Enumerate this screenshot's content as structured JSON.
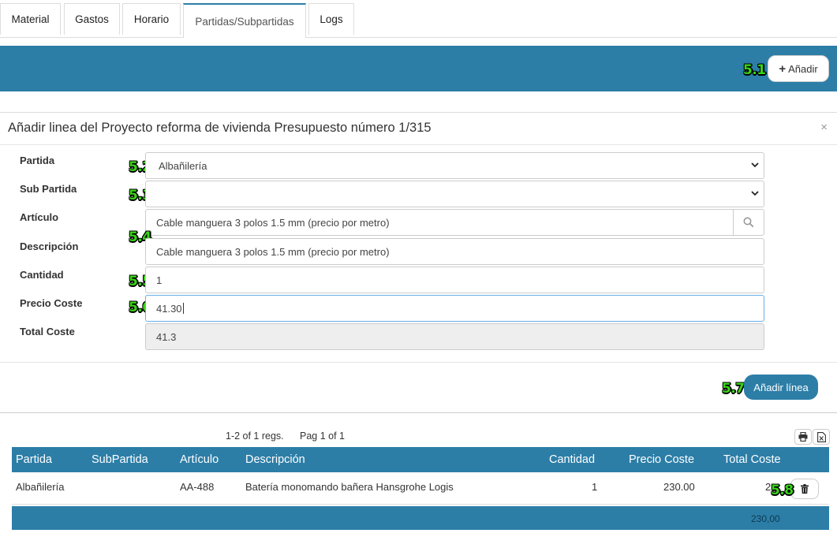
{
  "tabs": [
    {
      "label": "Material"
    },
    {
      "label": "Gastos"
    },
    {
      "label": "Horario"
    },
    {
      "label": "Partidas/Subpartidas",
      "active": true
    },
    {
      "label": "Logs"
    }
  ],
  "toolbar": {
    "add_label": "Añadir"
  },
  "badges": {
    "b51": "5.1",
    "b52": "5.2",
    "b53": "5.3",
    "b54": "5.4",
    "b55": "5.5",
    "b56": "5.6",
    "b57": "5.7",
    "b58": "5.8"
  },
  "form": {
    "title": "Añadir linea del Proyecto reforma de vivienda Presupuesto número 1/315",
    "close": "×",
    "partida_label": "Partida",
    "partida_value": "Albañilería",
    "subpartida_label": "Sub Partida",
    "subpartida_value": "",
    "articulo_label": "Artículo",
    "articulo_value": "Cable manguera 3 polos 1.5 mm (precio por metro)",
    "descripcion_label": "Descripción",
    "descripcion_value": "Cable manguera 3 polos 1.5 mm (precio por metro)",
    "cantidad_label": "Cantidad",
    "cantidad_value": "1",
    "precio_label": "Precio Coste",
    "precio_value": "41.30",
    "total_label": "Total Coste",
    "total_value": "41.3",
    "submit_label": "Añadir línea"
  },
  "table": {
    "records": "1-2 of 1 regs.",
    "pages": "Pag 1 of 1",
    "columns": [
      "Partida",
      "SubPartida",
      "Artículo",
      "Descripción",
      "Cantidad",
      "Precio Coste",
      "Total Coste"
    ],
    "rows": [
      {
        "partida": "Albañilería",
        "subpartida": "",
        "articulo": "AA-488",
        "descripcion": "Batería monomando bañera Hansgrohe Logis",
        "cantidad": "1",
        "precio": "230.00",
        "total": "2"
      }
    ],
    "footer_total": "230,00"
  },
  "colors": {
    "accent": "#2c7ea7",
    "badge": "#39d416"
  }
}
